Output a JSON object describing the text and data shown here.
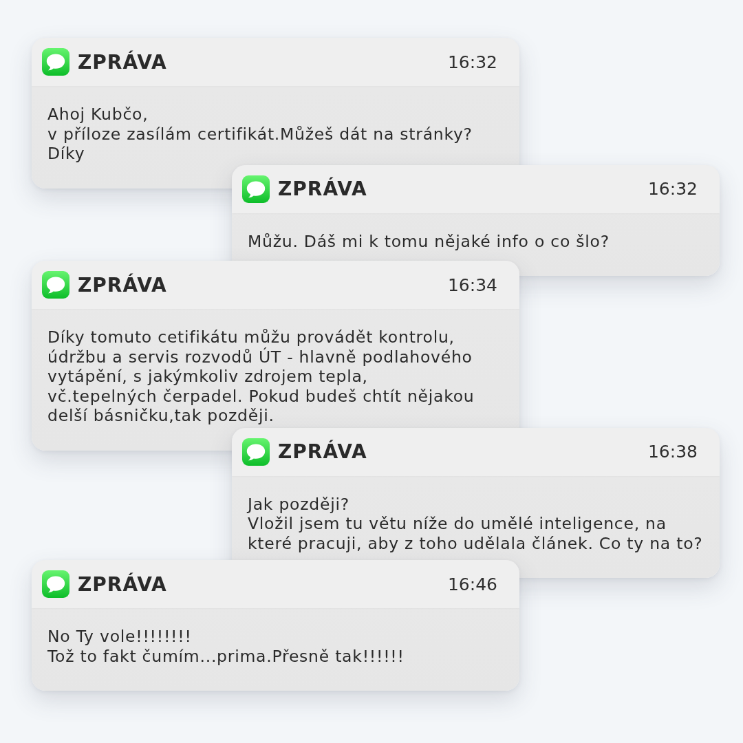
{
  "messages": [
    {
      "app": "ZPRÁVA",
      "time": "16:32",
      "text": "Ahoj Kubčo,\nv příloze zasílám certifikát.Můžeš dát na stránky?\nDíky"
    },
    {
      "app": "ZPRÁVA",
      "time": "16:32",
      "text": "Můžu. Dáš mi k tomu nějaké info o co šlo?"
    },
    {
      "app": "ZPRÁVA",
      "time": "16:34",
      "text": "Díky tomuto cetifikátu můžu provádět kontrolu,\núdržbu a servis rozvodů ÚT - hlavně podlahového\nvytápění, s jakýmkoliv zdrojem tepla,\nvč.tepelných čerpadel. Pokud budeš chtít nějakou\ndelší básničku,tak později."
    },
    {
      "app": "ZPRÁVA",
      "time": "16:38",
      "text": "Jak později?\nVložil jsem tu větu níže do umělé inteligence, na\nkteré pracuji, aby z toho udělala článek. Co ty na to?"
    },
    {
      "app": "ZPRÁVA",
      "time": "16:46",
      "text": "No Ty vole!!!!!!!!\nTož to fakt čumím...prima.Přesně tak!!!!!!"
    }
  ]
}
